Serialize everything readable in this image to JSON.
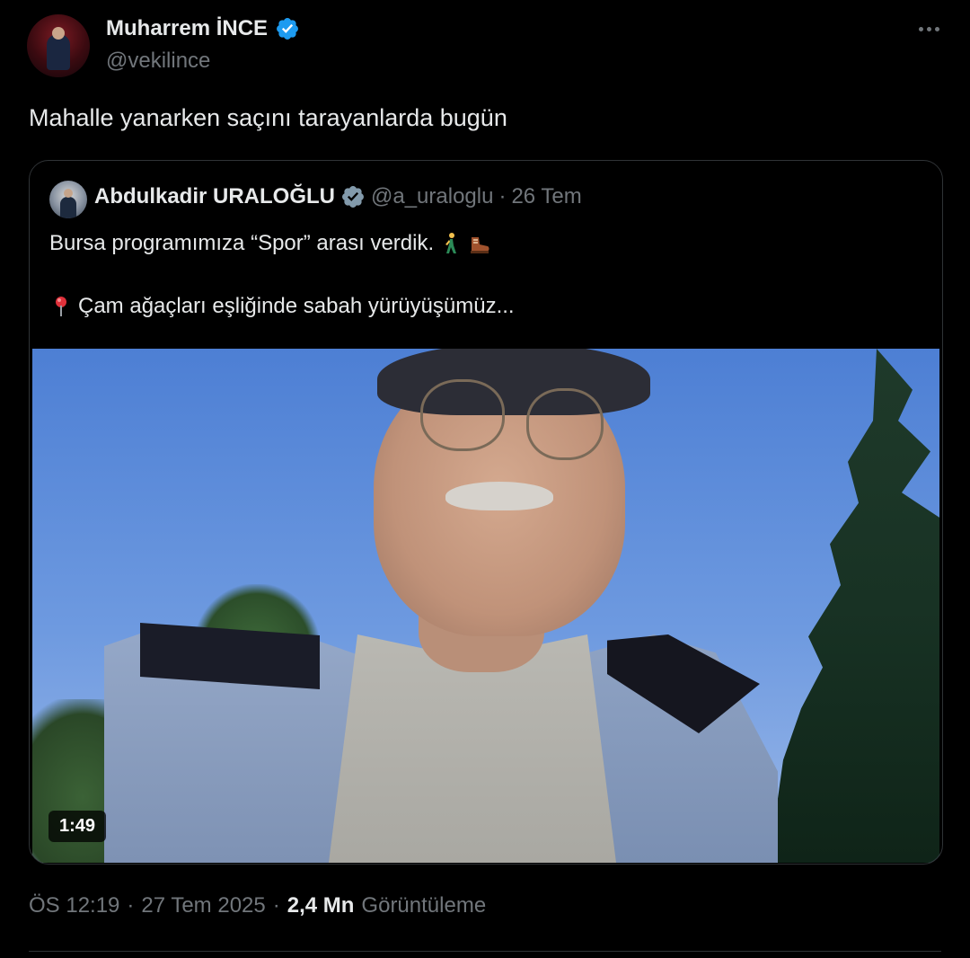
{
  "tweet": {
    "author": {
      "name": "Muharrem İNCE",
      "handle": "@vekilince",
      "verified": true
    },
    "text": "Mahalle yanarken saçını tarayanlarda bugün",
    "more_icon": "more-horizontal-icon"
  },
  "quote": {
    "author": {
      "name": "Abdulkadir URALOĞLU",
      "handle": "@a_uraloglu",
      "verified": true
    },
    "separator": "·",
    "date": "26 Tem",
    "line1": "Bursa programımıza “Spor” arası verdik.",
    "line1_emojis": [
      "person-walking-icon",
      "hiking-boot-icon"
    ],
    "line2": "Çam ağaçları eşliğinde sabah yürüyüşümüz...",
    "line2_icon": "round-pushpin-icon",
    "video": {
      "duration": "1:49"
    }
  },
  "meta": {
    "time": "ÖS 12:19",
    "sep1": "·",
    "date": "27 Tem 2025",
    "sep2": "·",
    "views_count": "2,4 Mn",
    "views_label": "Görüntüleme"
  },
  "colors": {
    "background": "#000000",
    "text_primary": "#e7e9ea",
    "text_secondary": "#71767b",
    "verified_blue": "#1d9bf0",
    "verified_gray": "#829aab",
    "border": "#2f3336"
  }
}
